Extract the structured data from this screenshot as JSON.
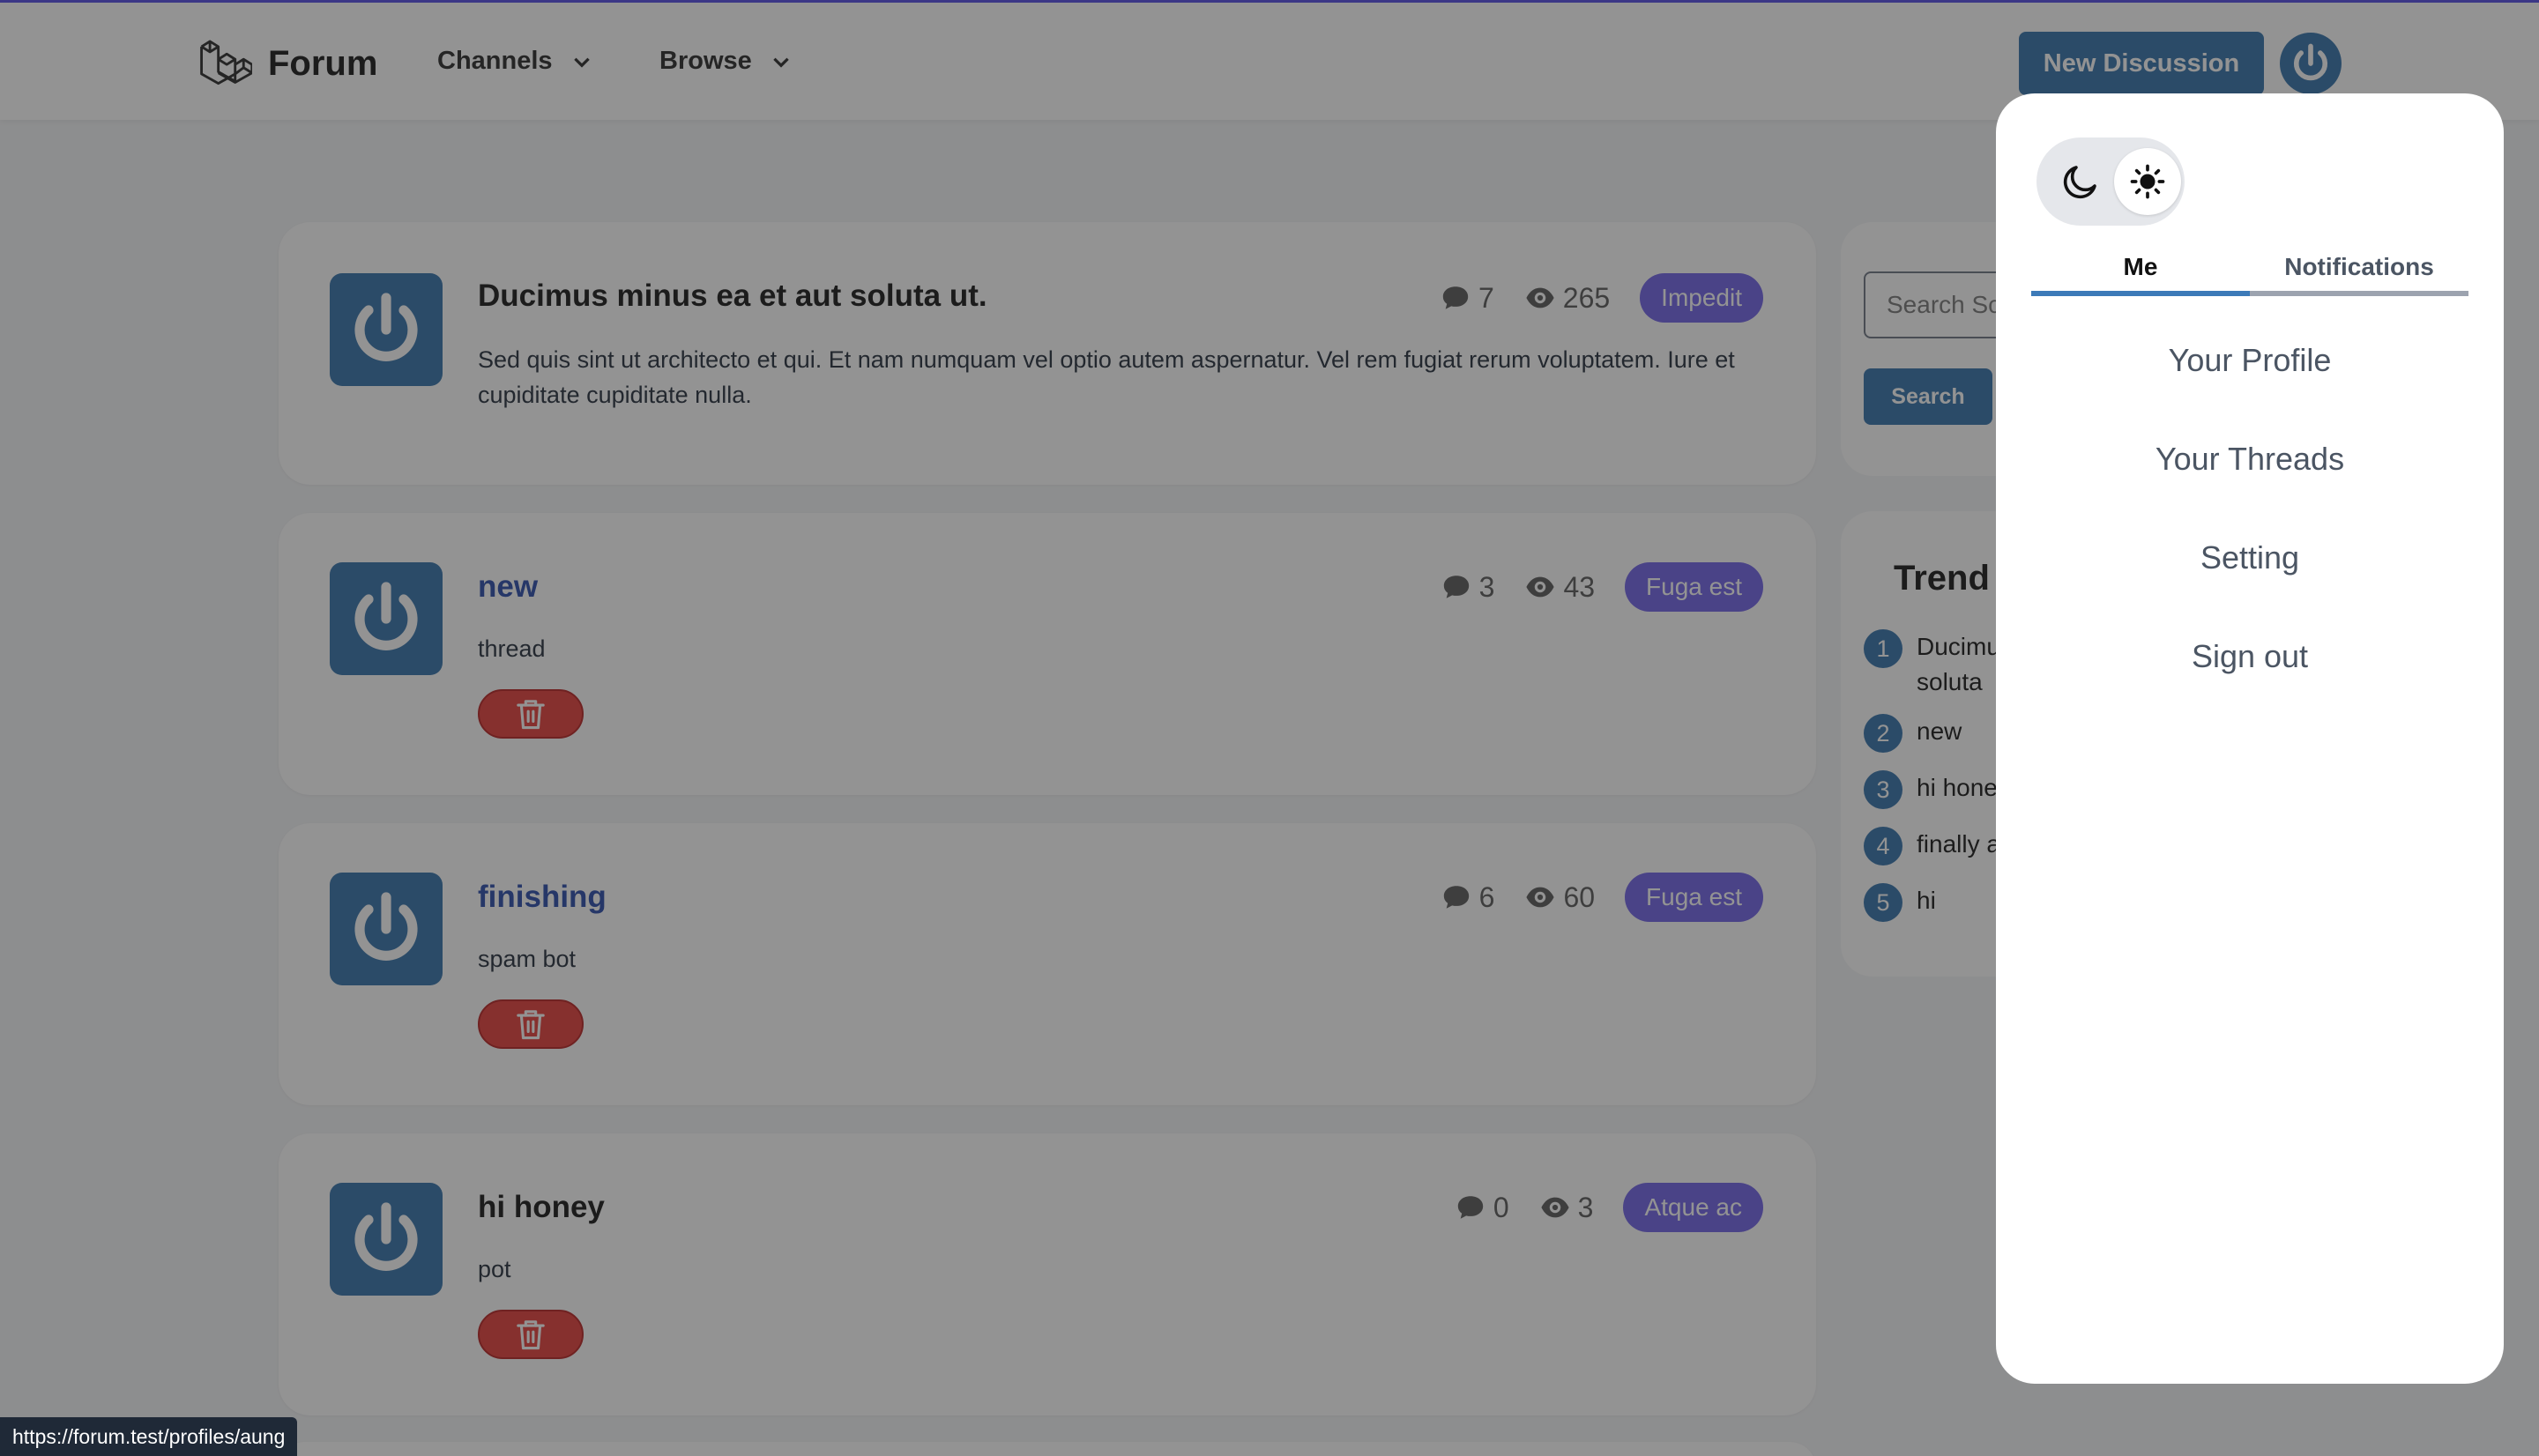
{
  "header": {
    "logo_text": "Forum",
    "nav": [
      {
        "label": "Channels",
        "icon": "chevron-down-icon"
      },
      {
        "label": "Browse",
        "icon": "chevron-down-icon"
      }
    ],
    "new_discussion_label": "New Discussion"
  },
  "threads": [
    {
      "title": "Ducimus minus ea et aut soluta ut.",
      "body": "Sed quis sint ut architecto et qui. Et nam numquam vel optio autem aspernatur. Vel rem fugiat rerum voluptatem. Iure et cupiditate cupiditate nulla.",
      "replies": "7",
      "views": "265",
      "channel": "Impedit",
      "deletable": false
    },
    {
      "title": "new",
      "body": "thread",
      "replies": "3",
      "views": "43",
      "channel": "Fuga est",
      "deletable": true
    },
    {
      "title": "finishing",
      "body": "spam bot",
      "replies": "6",
      "views": "60",
      "channel": "Fuga est",
      "deletable": true
    },
    {
      "title": "hi honey",
      "body": "pot",
      "replies": "0",
      "views": "3",
      "channel": "Atque ac",
      "deletable": true
    }
  ],
  "sidebar": {
    "search_placeholder": "Search Sc",
    "search_button": "Search",
    "trending_title": "Trend",
    "trending": [
      {
        "num": "1",
        "text": "Ducimu",
        "text2": "soluta"
      },
      {
        "num": "2",
        "text": "new"
      },
      {
        "num": "3",
        "text": "hi hone"
      },
      {
        "num": "4",
        "text": "finally a"
      },
      {
        "num": "5",
        "text": "hi"
      }
    ]
  },
  "dropdown": {
    "tabs": [
      "Me",
      "Notifications"
    ],
    "active_tab": "Me",
    "menu": [
      "Your Profile",
      "Your Threads",
      "Setting",
      "Sign out"
    ],
    "theme_icons": [
      "moon-icon",
      "sun-icon"
    ],
    "theme_selected": "sun-icon"
  },
  "status_url": "https://forum.test/profiles/aung",
  "colors": {
    "primary": "#2f6ea8",
    "channel": "#6d5ee6",
    "danger": "#e53935",
    "link": "#2446a8"
  }
}
